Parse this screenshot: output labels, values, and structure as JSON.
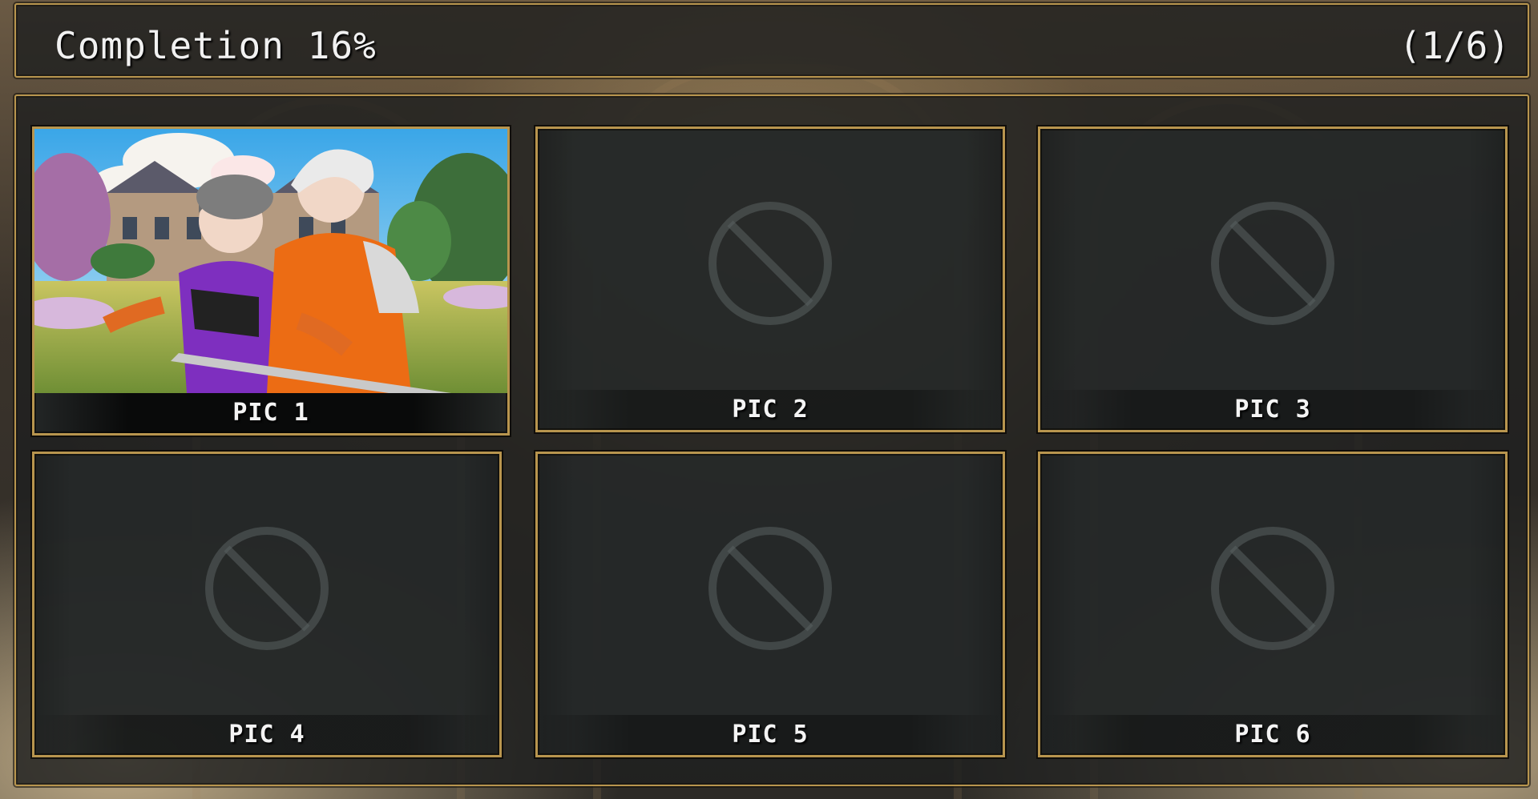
{
  "header": {
    "title": "Completion 16%",
    "count": "(1/6)"
  },
  "gallery": {
    "items": [
      {
        "label": "PIC 1",
        "unlocked": true,
        "thumbnail": "couple-in-garden-illustration"
      },
      {
        "label": "PIC 2",
        "unlocked": false,
        "icon": "locked-prohibited-icon"
      },
      {
        "label": "PIC 3",
        "unlocked": false,
        "icon": "locked-prohibited-icon"
      },
      {
        "label": "PIC 4",
        "unlocked": false,
        "icon": "locked-prohibited-icon"
      },
      {
        "label": "PIC 5",
        "unlocked": false,
        "icon": "locked-prohibited-icon"
      },
      {
        "label": "PIC 6",
        "unlocked": false,
        "icon": "locked-prohibited-icon"
      }
    ]
  },
  "colors": {
    "frame_gold": "#b8954e",
    "panel_dark": "#1e2020",
    "text": "#f1f1f1"
  }
}
